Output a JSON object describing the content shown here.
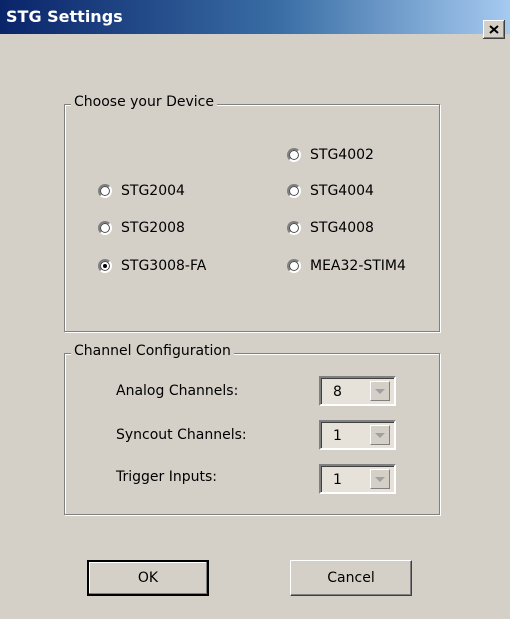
{
  "window": {
    "title": "STG Settings"
  },
  "device_group": {
    "legend": "Choose your Device",
    "options": [
      {
        "label": "STG4002",
        "checked": false
      },
      {
        "label": "STG2004",
        "checked": false
      },
      {
        "label": "STG4004",
        "checked": false
      },
      {
        "label": "STG2008",
        "checked": false
      },
      {
        "label": "STG4008",
        "checked": false
      },
      {
        "label": "STG3008-FA",
        "checked": true
      },
      {
        "label": "MEA32-STIM4",
        "checked": false
      }
    ]
  },
  "channel_group": {
    "legend": "Channel Configuration",
    "rows": [
      {
        "label": "Analog Channels:",
        "value": "8"
      },
      {
        "label": "Syncout Channels:",
        "value": "1"
      },
      {
        "label": "Trigger Inputs:",
        "value": "1"
      }
    ]
  },
  "buttons": {
    "ok": "OK",
    "cancel": "Cancel"
  }
}
